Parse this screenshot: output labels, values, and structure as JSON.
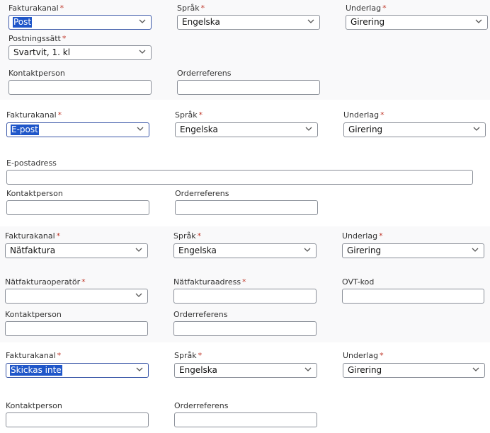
{
  "labels": {
    "invoice_channel": "Fakturakanal",
    "language": "Språk",
    "basis": "Underlag",
    "posting_method": "Postningssätt",
    "contact_person": "Kontaktperson",
    "order_reference": "Orderreferens",
    "email_address": "E-postadress",
    "einvoice_operator": "Nätfakturaoperatör",
    "einvoice_address": "Nätfakturaadress",
    "ovt_code": "OVT-kod"
  },
  "required_mark": "*",
  "form_post": {
    "invoice_channel": "Post",
    "language": "Engelska",
    "basis": "Girering",
    "posting_method": "Svartvit, 1. kl",
    "contact_person": "",
    "order_reference": ""
  },
  "form_email": {
    "invoice_channel": "E-post",
    "language": "Engelska",
    "basis": "Girering",
    "email_address": "",
    "contact_person": "",
    "order_reference": ""
  },
  "form_einvoice": {
    "invoice_channel": "Nätfaktura",
    "language": "Engelska",
    "basis": "Girering",
    "einvoice_operator": "",
    "einvoice_address": "",
    "ovt_code": "",
    "contact_person": "",
    "order_reference": ""
  },
  "form_none": {
    "invoice_channel": "Skickas inte",
    "language": "Engelska",
    "basis": "Girering",
    "contact_person": "",
    "order_reference": ""
  },
  "colors": {
    "required": "#c0392b",
    "selection": "#1f56c9",
    "border": "#8a8f98"
  },
  "icons": {
    "dropdown": "chevron-down-icon"
  }
}
